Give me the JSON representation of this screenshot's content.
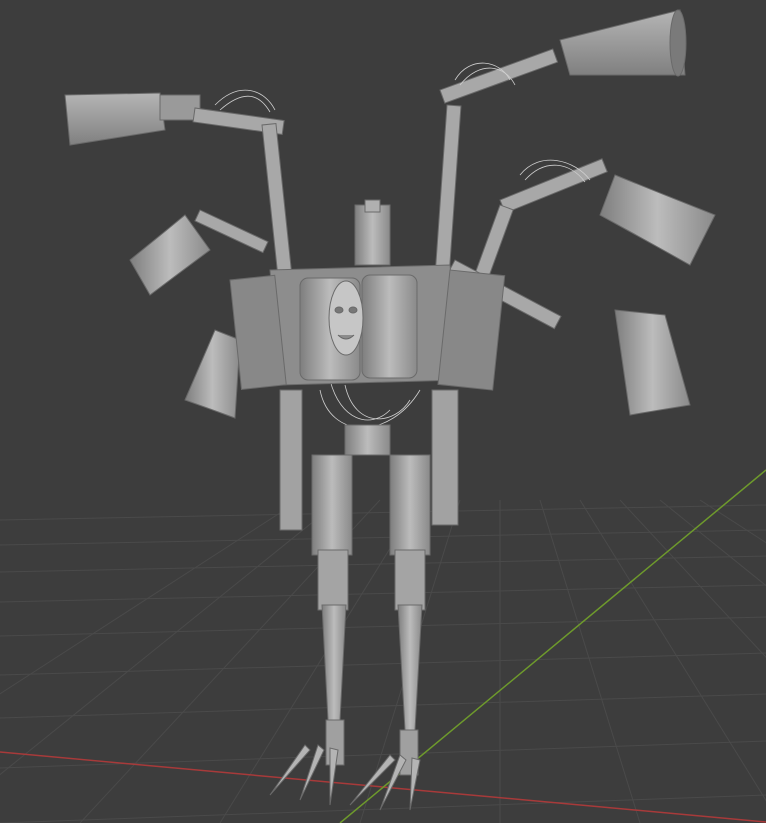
{
  "viewport": {
    "background": "#3d3d3d",
    "grid_color": "#4a4a4a",
    "x_axis_color": "#a83a3a",
    "y_axis_color": "#6e9a2c",
    "model_color": "#9c9c9c",
    "model_shadow": "#7a7a7a",
    "model_highlight": "#bdbdbd"
  },
  "model": {
    "name": "mechanical-multi-arm-robot"
  }
}
